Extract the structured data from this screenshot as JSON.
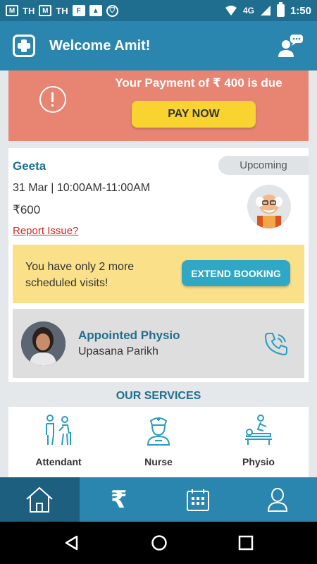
{
  "status_bar": {
    "left_icons": [
      "gmail-icon",
      "th-text",
      "gmail-icon",
      "th-text",
      "f-icon",
      "image-icon",
      "shield-icon"
    ],
    "th_label": "TH",
    "f_label": "F",
    "network": "4G",
    "time": "1:50"
  },
  "header": {
    "title": "Welcome Amit!"
  },
  "payment": {
    "message": "Your Payment of ₹ 400 is due",
    "button_label": "PAY NOW"
  },
  "booking": {
    "name": "Geeta",
    "status": "Upcoming",
    "schedule": "31 Mar | 10:00AM-11:00AM",
    "price": "₹600",
    "report_link": "Report Issue?",
    "extend_message": "You have only 2 more scheduled visits!",
    "extend_button": "EXTEND BOOKING",
    "physio_heading": "Appointed Physio",
    "physio_name": "Upasana Parikh"
  },
  "services": {
    "title": "OUR SERVICES",
    "items": [
      {
        "label": "Attendant",
        "icon": "attendant-icon"
      },
      {
        "label": "Nurse",
        "icon": "nurse-icon"
      },
      {
        "label": "Physio",
        "icon": "physio-icon"
      }
    ]
  },
  "bottom_nav": {
    "items": [
      {
        "icon": "home-icon",
        "active": false
      },
      {
        "icon": "rupee-icon",
        "active": true
      },
      {
        "icon": "calendar-icon",
        "active": false
      },
      {
        "icon": "profile-icon",
        "active": false
      }
    ],
    "rupee_glyph": "₹"
  },
  "colors": {
    "status_bar": "#1f6e8f",
    "header": "#2a86ae",
    "payment_banner": "#e88572",
    "pay_button": "#f9d430",
    "extend_box": "#fbe08a",
    "extend_button": "#2fa8c6",
    "accent_text": "#1f6e8f",
    "report_link": "#d8261f"
  }
}
